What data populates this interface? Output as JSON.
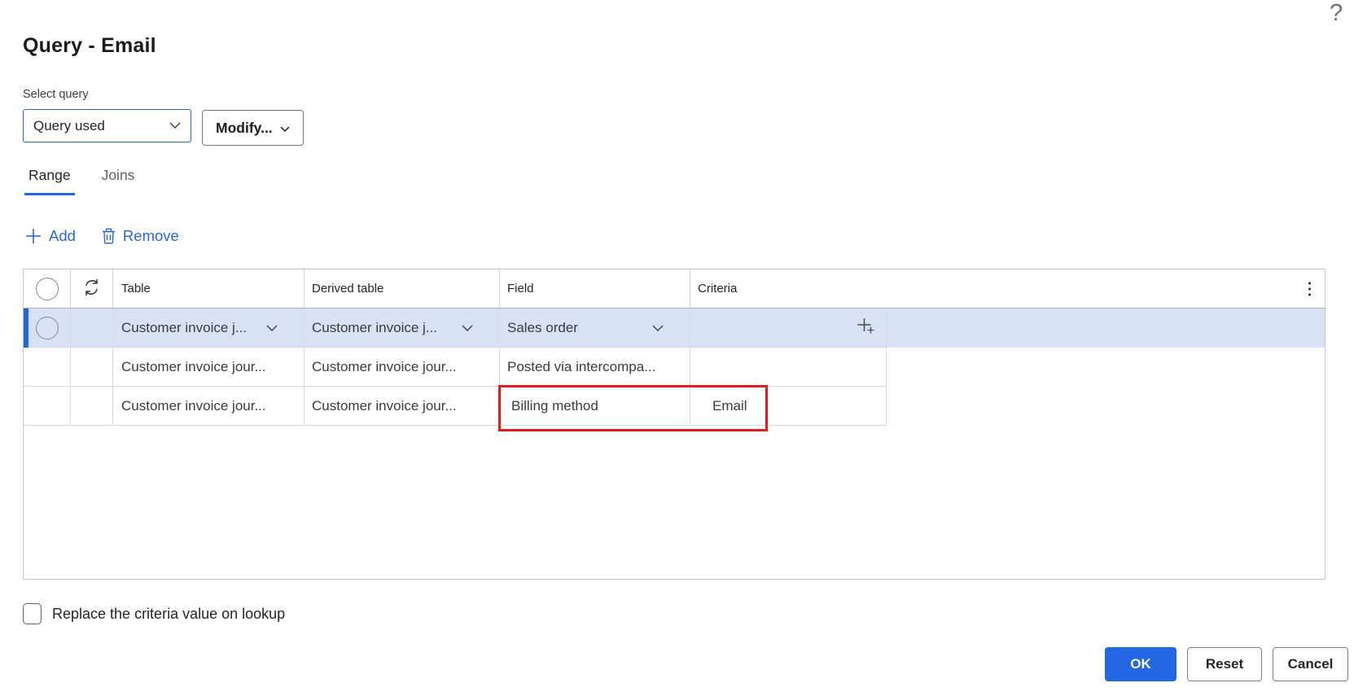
{
  "help_label": "?",
  "title": "Query - Email",
  "select_query": {
    "label": "Select query",
    "value": "Query used"
  },
  "modify_button": {
    "label": "Modify..."
  },
  "tabs": [
    {
      "label": "Range",
      "active": true
    },
    {
      "label": "Joins",
      "active": false
    }
  ],
  "toolbar": {
    "add_label": "Add",
    "remove_label": "Remove"
  },
  "grid": {
    "columns": [
      "Table",
      "Derived table",
      "Field",
      "Criteria"
    ],
    "rows": [
      {
        "table": "Customer invoice j...",
        "derived": "Customer invoice j...",
        "field": "Sales order",
        "criteria": "",
        "selected": true
      },
      {
        "table": "Customer invoice jour...",
        "derived": "Customer invoice jour...",
        "field": "Posted via intercompa...",
        "criteria": "",
        "selected": false
      },
      {
        "table": "Customer invoice jour...",
        "derived": "Customer invoice jour...",
        "field": "Billing method",
        "criteria": "Email",
        "selected": false,
        "highlighted": true
      }
    ]
  },
  "checkbox": {
    "label": "Replace the criteria value on lookup",
    "checked": false
  },
  "footer_buttons": {
    "ok": "OK",
    "reset": "Reset",
    "cancel": "Cancel"
  },
  "icons": {
    "help": "question-mark",
    "add": "plus",
    "remove": "trash",
    "refresh": "sync-arrows",
    "dropdown": "chevron-down",
    "criteria_lookup": "add-filter",
    "more": "vertical-ellipsis"
  },
  "colors": {
    "accent": "#2266E3",
    "selected_row": "#d8e2f7",
    "highlight_red": "#e11d1d",
    "grid_border": "#c6c6c6",
    "text": "#242424"
  }
}
